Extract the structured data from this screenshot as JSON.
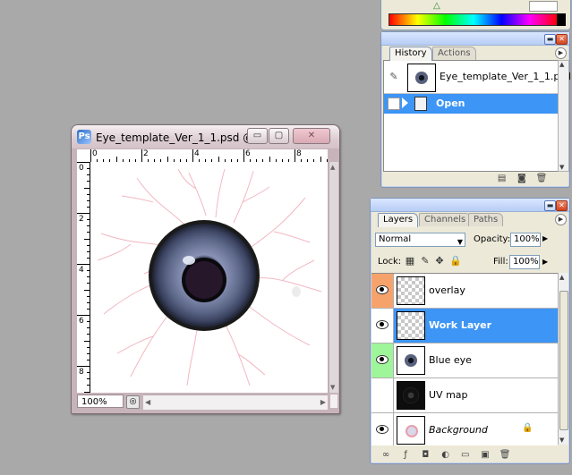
{
  "colors": {
    "selection": "#3d95f5",
    "overlay_vis": "#f6a36b",
    "blue_eye_vis": "#9ff59a"
  },
  "document": {
    "title": "Eye_template_Ver_1_1.psd @...",
    "zoom": "100%",
    "ruler_top": [
      "0",
      "2",
      "4",
      "6",
      "8"
    ],
    "ruler_left": [
      "0",
      "2",
      "4",
      "6",
      "8"
    ],
    "buttons": {
      "minimize": "▭",
      "maximize": "▢",
      "close": "✕"
    }
  },
  "history": {
    "tabs": [
      "History",
      "Actions"
    ],
    "snapshot_name": "Eye_template_Ver_1_1.psd",
    "states": [
      {
        "label": "Open",
        "selected": true
      }
    ]
  },
  "layers": {
    "tabs": [
      "Layers",
      "Channels",
      "Paths"
    ],
    "blend_mode": "Normal",
    "opacity_label": "Opacity:",
    "opacity_value": "100%",
    "lock_label": "Lock:",
    "fill_label": "Fill:",
    "fill_value": "100%",
    "items": [
      {
        "name": "overlay",
        "visible": true,
        "selected": false,
        "italic": false,
        "thumb": "checker",
        "vis_color": "overlay"
      },
      {
        "name": "Work Layer",
        "visible": true,
        "selected": true,
        "italic": false,
        "thumb": "checker",
        "vis_color": "selected"
      },
      {
        "name": "Blue eye",
        "visible": true,
        "selected": false,
        "italic": false,
        "thumb": "eye",
        "vis_color": "green"
      },
      {
        "name": "UV map",
        "visible": false,
        "selected": false,
        "italic": false,
        "thumb": "uv",
        "vis_color": "none"
      },
      {
        "name": "Background",
        "visible": true,
        "selected": false,
        "italic": true,
        "thumb": "bg",
        "vis_color": "none",
        "locked": true
      }
    ],
    "bottom_icons": [
      "link-icon",
      "layer-style-icon",
      "mask-icon",
      "adjustment-icon",
      "group-icon",
      "new-layer-icon",
      "trash-icon"
    ]
  },
  "history_bottom_icons": [
    "new-document-icon",
    "snapshot-icon",
    "trash-icon"
  ]
}
